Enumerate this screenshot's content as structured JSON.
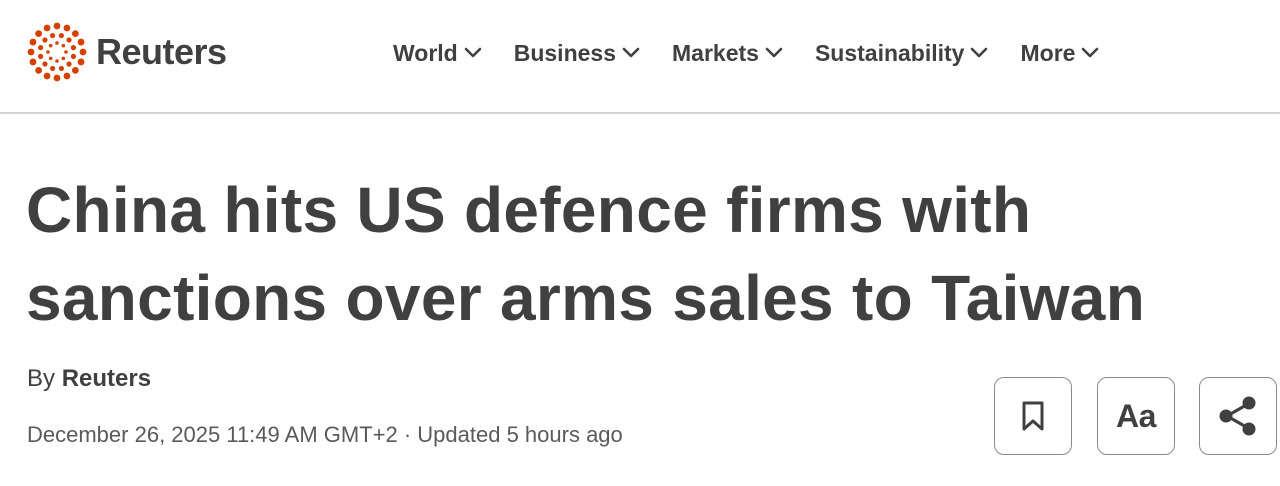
{
  "brand": {
    "name": "Reuters",
    "accent_color": "#d64000"
  },
  "nav": {
    "items": [
      {
        "label": "World"
      },
      {
        "label": "Business"
      },
      {
        "label": "Markets"
      },
      {
        "label": "Sustainability"
      },
      {
        "label": "More"
      }
    ]
  },
  "article": {
    "headline_line1": "China hits US defence firms with",
    "headline_line2": "sanctions over arms sales to Taiwan",
    "byline_prefix": "By",
    "author": "Reuters",
    "dateline": "December 26, 2025 11:49 AM GMT+2 · Updated 5 hours ago"
  },
  "tools": {
    "bookmark_icon": "bookmark-icon",
    "text_size_label": "Aa",
    "share_icon": "share-icon"
  }
}
